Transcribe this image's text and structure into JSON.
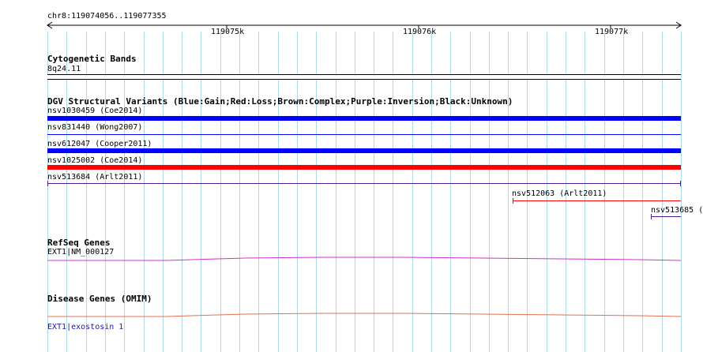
{
  "ruler": {
    "location": "chr8:119074056..119077355",
    "ticks": [
      "119075k",
      "119076k",
      "119077k"
    ]
  },
  "tracks": {
    "cytoband": {
      "title": "Cytogenetic Bands",
      "band_label": "8q24.11"
    },
    "dgv": {
      "title": "DGV Structural Variants (Blue:Gain;Red:Loss;Brown:Complex;Purple:Inversion;Black:Unknown)",
      "features": [
        {
          "label": "nsv1030459 (Coe2014)",
          "type": "Gain",
          "color": "#0000ff"
        },
        {
          "label": "nsv831440 (Wong2007)",
          "type": "Gain",
          "color": "#0000ff"
        },
        {
          "label": "nsv612047 (Cooper2011)",
          "type": "Gain",
          "color": "#0000ff"
        },
        {
          "label": "nsv1025002 (Coe2014)",
          "type": "Loss",
          "color": "#ff0000"
        },
        {
          "label": "nsv513684 (Arlt2011)",
          "type": "Unknown",
          "color": "#551a8b"
        },
        {
          "label": "nsv512063 (Arlt2011)",
          "type": "Loss",
          "color": "#ff0000"
        },
        {
          "label": "nsv513685 (",
          "type": "Unknown",
          "color": "#551a8b"
        }
      ]
    },
    "refseq": {
      "title": "RefSeq Genes",
      "gene_label": "EXT1|NM_000127",
      "color": "#cc33cc"
    },
    "disease": {
      "title": "Disease Genes (OMIM)",
      "gene_label": "EXT1|exostosin 1",
      "color": "#e07050",
      "label_color": "#1a1aa6"
    }
  },
  "colors": {
    "grid": "#add8e6",
    "gain": "#0000ff",
    "loss": "#ff0000"
  }
}
